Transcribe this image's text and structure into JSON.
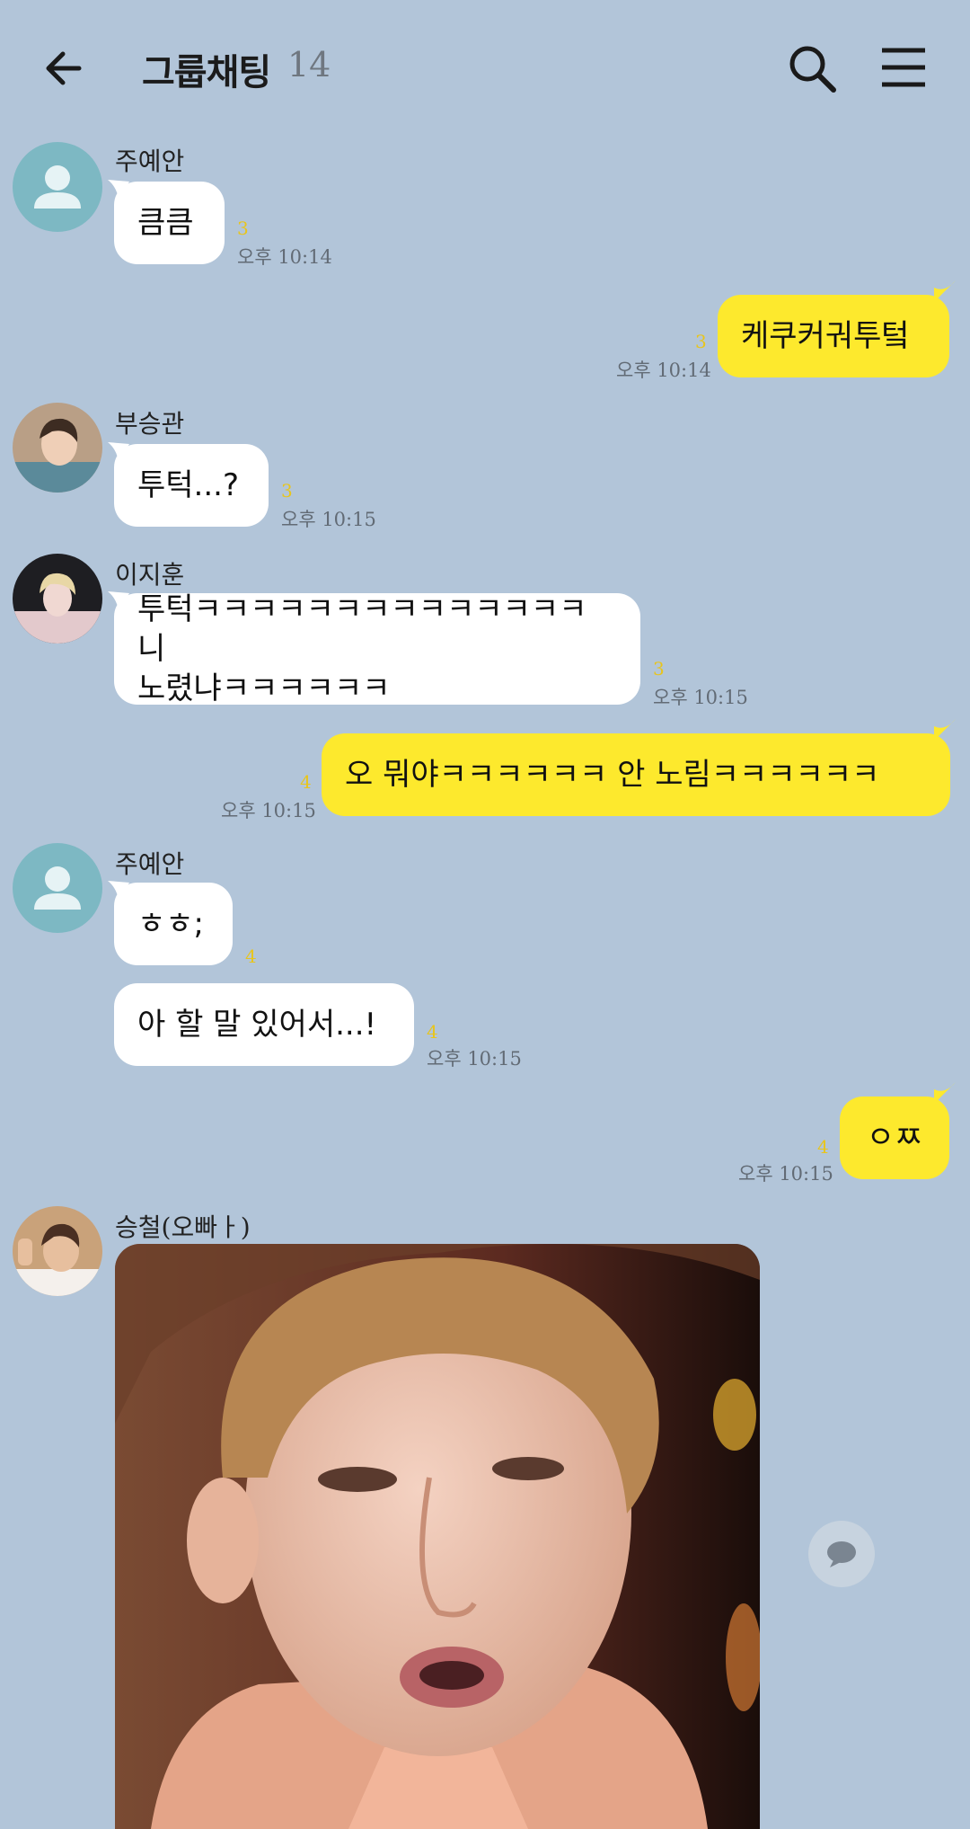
{
  "header": {
    "title": "그룹채팅",
    "member_count": "14"
  },
  "messages": [
    {
      "sender": "주예안",
      "avatar": "default-avatar",
      "texts": [
        "큼큼"
      ],
      "unread": "3",
      "time": "오후 10:14"
    },
    {
      "mine": true,
      "texts": [
        "케쿠커궈투텈"
      ],
      "unread": "3",
      "time": "오후 10:14"
    },
    {
      "sender": "부승관",
      "avatar": "profile-photo",
      "texts": [
        "투턱...?"
      ],
      "unread": "3",
      "time": "오후 10:15"
    },
    {
      "sender": "이지훈",
      "avatar": "profile-photo",
      "texts": [
        "투턱ㅋㅋㅋㅋㅋㅋㅋㅋㅋㅋㅋㅋㅋㅋ 니",
        "노렸냐ㅋㅋㅋㅋㅋㅋ"
      ],
      "unread": "3",
      "time": "오후 10:15"
    },
    {
      "mine": true,
      "texts": [
        "오 뭐야ㅋㅋㅋㅋㅋㅋ 안 노림ㅋㅋㅋㅋㅋㅋ"
      ],
      "unread": "4",
      "time": "오후 10:15"
    },
    {
      "sender": "주예안",
      "avatar": "default-avatar",
      "texts": [
        "ㅎㅎ;"
      ],
      "unread": "4",
      "time": ""
    },
    {
      "texts": [
        "아 할 말 있어서...!"
      ],
      "unread": "4",
      "time": "오후 10:15"
    },
    {
      "mine": true,
      "texts": [
        "ㅇㅉ"
      ],
      "unread": "4",
      "time": "오후 10:15"
    },
    {
      "sender": "승철(오빠ㅏ)",
      "avatar": "profile-photo",
      "attachment": "photo",
      "share_icon": "speech-bubble-icon"
    }
  ],
  "colors": {
    "background": "#b2c5d9",
    "my_bubble": "#fde92d",
    "other_bubble": "#ffffff",
    "unread": "#e8c51c"
  }
}
